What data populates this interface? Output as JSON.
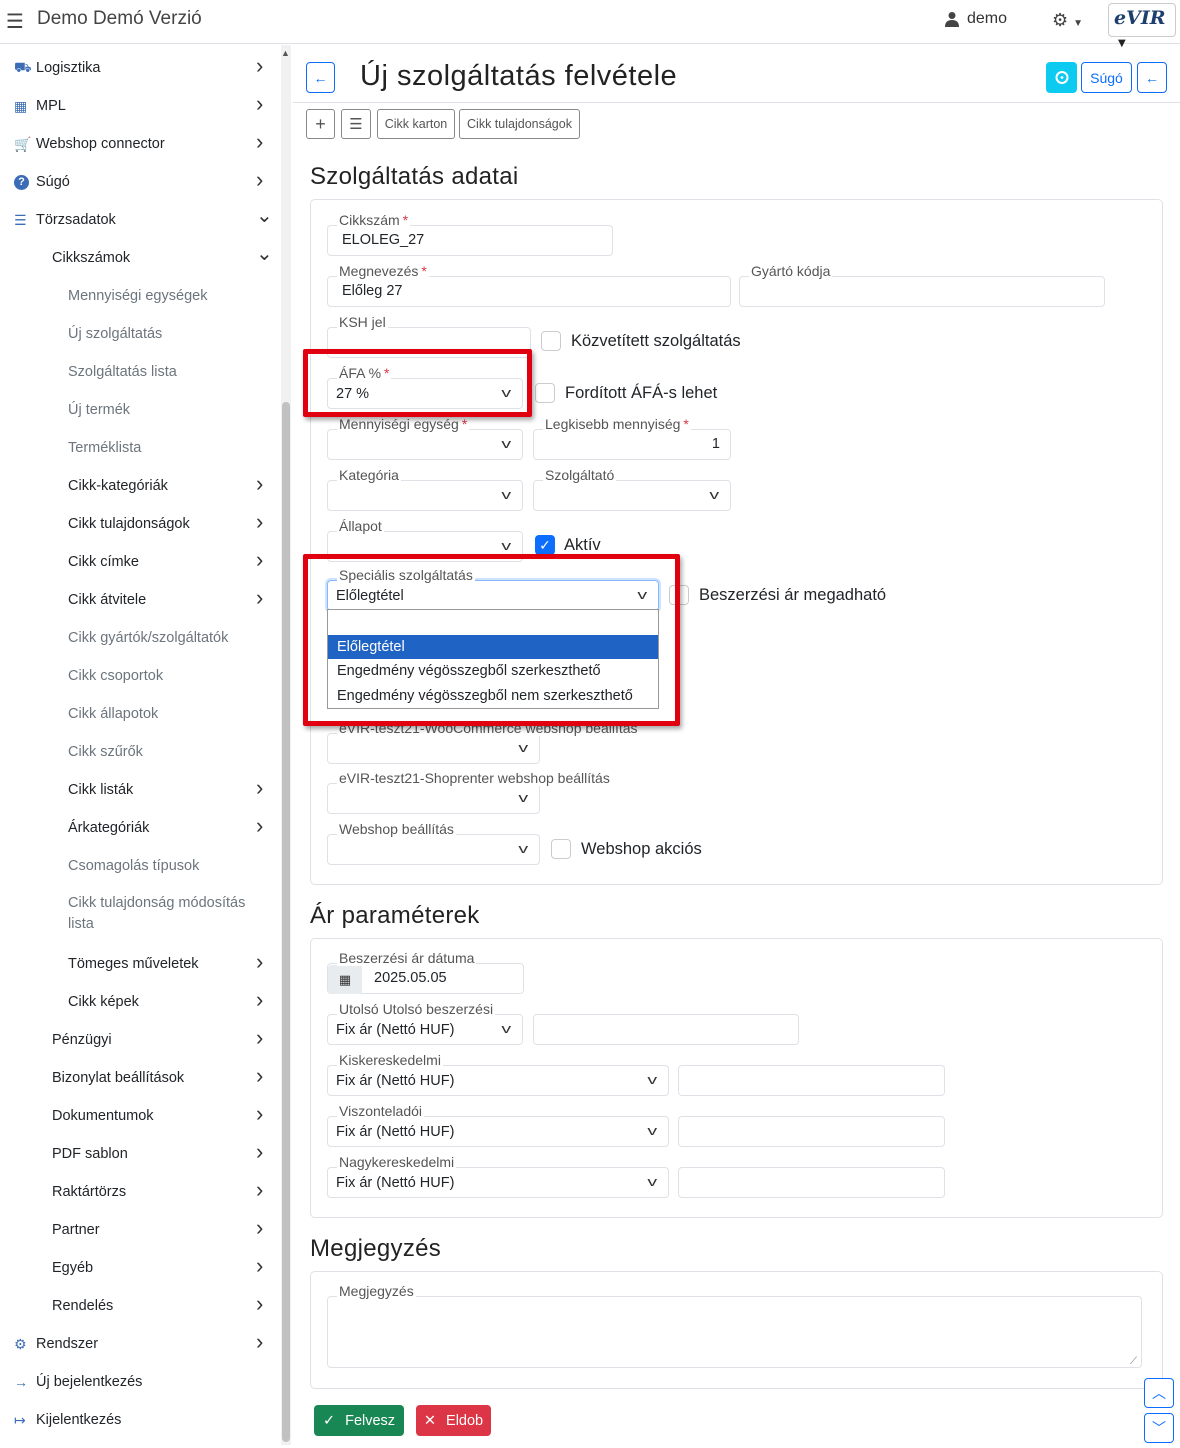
{
  "topbar": {
    "title": "Demo Demó Verzió",
    "user": "demo",
    "logo_text": "eVIR"
  },
  "sidebar": {
    "items": [
      {
        "label": "Logisztika",
        "icon": "truck-loading-icon",
        "level": 0,
        "chevron": ">"
      },
      {
        "label": "MPL",
        "icon": "pallet-icon",
        "level": 0,
        "chevron": ">"
      },
      {
        "label": "Webshop connector",
        "icon": "cart-icon",
        "level": 0,
        "chevron": ">"
      },
      {
        "label": "Súgó",
        "icon": "question-circle-icon",
        "level": 0,
        "chevron": ">"
      },
      {
        "label": "Törzsadatok",
        "icon": "database-icon",
        "level": 0,
        "chevron": "v"
      },
      {
        "label": "Cikkszámok",
        "level": 1,
        "chevron": "v"
      },
      {
        "label": "Mennyiségi egységek",
        "level": 2
      },
      {
        "label": "Új szolgáltatás",
        "level": 2
      },
      {
        "label": "Szolgáltatás lista",
        "level": 2
      },
      {
        "label": "Új termék",
        "level": 2
      },
      {
        "label": "Terméklista",
        "level": 2
      },
      {
        "label": "Cikk-kategóriák",
        "level": 2,
        "dark": true,
        "chevron": ">"
      },
      {
        "label": "Cikk tulajdonságok",
        "level": 2,
        "dark": true,
        "chevron": ">"
      },
      {
        "label": "Cikk címke",
        "level": 2,
        "dark": true,
        "chevron": ">"
      },
      {
        "label": "Cikk átvitele",
        "level": 2,
        "dark": true,
        "chevron": ">"
      },
      {
        "label": "Cikk gyártók/szolgáltatók",
        "level": 2
      },
      {
        "label": "Cikk csoportok",
        "level": 2
      },
      {
        "label": "Cikk állapotok",
        "level": 2
      },
      {
        "label": "Cikk szűrők",
        "level": 2
      },
      {
        "label": "Cikk listák",
        "level": 2,
        "dark": true,
        "chevron": ">"
      },
      {
        "label": "Árkategóriák",
        "level": 2,
        "dark": true,
        "chevron": ">"
      },
      {
        "label": "Csomagolás típusok",
        "level": 2
      },
      {
        "label": "Cikk tulajdonság módosítás lista",
        "level": 2,
        "twoline": true
      },
      {
        "label": "Tömeges műveletek",
        "level": 2,
        "dark": true,
        "chevron": ">"
      },
      {
        "label": "Cikk képek",
        "level": 2,
        "dark": true,
        "chevron": ">"
      },
      {
        "label": "Pénzügyi",
        "level": 1,
        "chevron": ">"
      },
      {
        "label": "Bizonylat beállítások",
        "level": 1,
        "chevron": ">"
      },
      {
        "label": "Dokumentumok",
        "level": 1,
        "chevron": ">"
      },
      {
        "label": "PDF sablon",
        "level": 1,
        "chevron": ">"
      },
      {
        "label": "Raktártörzs",
        "level": 1,
        "chevron": ">"
      },
      {
        "label": "Partner",
        "level": 1,
        "chevron": ">"
      },
      {
        "label": "Egyéb",
        "level": 1,
        "chevron": ">"
      },
      {
        "label": "Rendelés",
        "level": 1,
        "chevron": ">"
      },
      {
        "label": "Rendszer",
        "icon": "cogs-icon",
        "level": 0,
        "chevron": ">"
      },
      {
        "label": "Új bejelentkezés",
        "icon": "sign-in-icon",
        "level": 0
      },
      {
        "label": "Kijelentkezés",
        "icon": "sign-out-icon",
        "level": 0
      }
    ]
  },
  "header": {
    "title": "Új szolgáltatás felvétele",
    "help_label": "Súgó",
    "tools": {
      "card_label": "Cikk karton",
      "props_label": "Cikk tulajdonságok"
    }
  },
  "service": {
    "section_title": "Szolgáltatás adatai",
    "cikkszam_label": "Cikkszám",
    "cikkszam_value": "ELOLEG_27",
    "megnevezes_label": "Megnevezés",
    "megnevezes_value": "Előleg 27",
    "gyarto_label": "Gyártó kódja",
    "ksh_label": "KSH jel",
    "kozvetitett_label": "Közvetített szolgáltatás",
    "afa_label": "ÁFA %",
    "afa_value": "27 %",
    "forditott_label": "Fordított ÁFÁ-s lehet",
    "menny_label": "Mennyiségi egység",
    "legkisebb_label": "Legkisebb mennyiség",
    "legkisebb_value": "1",
    "kategoria_label": "Kategória",
    "szolgaltato_label": "Szolgáltató",
    "allapot_label": "Állapot",
    "aktiv_label": "Aktív",
    "specialis_label": "Speciális szolgáltatás",
    "specialis_value": "Előlegtétel",
    "beszerzesi_label": "Beszerzési ár megadható",
    "dropdown_options": [
      "",
      "Előlegtétel",
      "Engedmény végösszegből szerkeszthető",
      "Engedmény végösszegből nem szerkeszthető"
    ],
    "woo_label": "eVIR-teszt21-WooCommerce webshop beállítás",
    "shoprenter_label": "eVIR-teszt21-Shoprenter webshop beállítás",
    "webshop_label": "Webshop beállítás",
    "webshop_akcios_label": "Webshop akciós"
  },
  "price": {
    "section_title": "Ár paraméterek",
    "date_label": "Beszerzési ár dátuma",
    "date_value": "2025.05.05",
    "utolso_label": "Utolsó Utolsó beszerzési",
    "utolso_value": "Fix ár (Nettó HUF)",
    "kisker_label": "Kiskereskedelmi",
    "kisker_value": "Fix ár (Nettó HUF)",
    "viszont_label": "Viszonteladói",
    "viszont_value": "Fix ár (Nettó HUF)",
    "nagyker_label": "Nagykereskedelmi",
    "nagyker_value": "Fix ár (Nettó HUF)"
  },
  "note": {
    "section_title": "Megjegyzés",
    "label": "Megjegyzés"
  },
  "actions": {
    "save_label": "Felvesz",
    "discard_label": "Eldob"
  },
  "colors": {
    "primary": "#0d6efd",
    "success": "#198754",
    "danger": "#dc3545",
    "highlight": "#e0000f",
    "info": "#0dcaf0"
  }
}
